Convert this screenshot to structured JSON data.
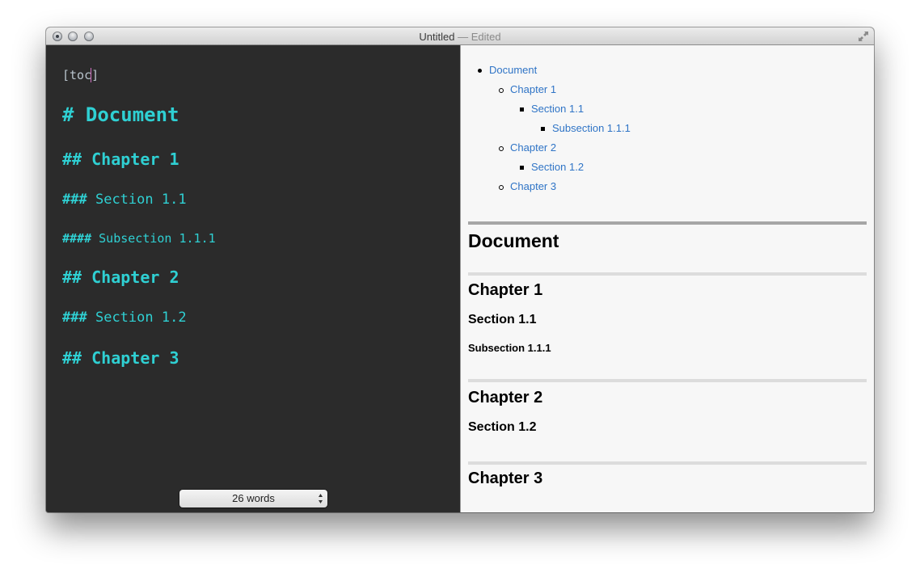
{
  "window": {
    "title": "Untitled",
    "separator": "—",
    "status": "Edited"
  },
  "editor": {
    "toc_tag_before_caret": "[toc",
    "toc_tag_after_caret": "]",
    "lines": [
      {
        "hash": "#",
        "text": "Document",
        "level": 1
      },
      {
        "hash": "##",
        "text": "Chapter 1",
        "level": 2
      },
      {
        "hash": "###",
        "text": "Section 1.1",
        "level": 3
      },
      {
        "hash": "####",
        "text": "Subsection 1.1.1",
        "level": 4
      },
      {
        "hash": "##",
        "text": "Chapter 2",
        "level": 2
      },
      {
        "hash": "###",
        "text": "Section 1.2",
        "level": 3
      },
      {
        "hash": "##",
        "text": "Chapter 3",
        "level": 2
      }
    ],
    "word_count": "26 words",
    "heading_color": "#2fd0d3",
    "background": "#2b2b2b"
  },
  "preview": {
    "toc": [
      {
        "label": "Document",
        "level": 1
      },
      {
        "label": "Chapter 1",
        "level": 2
      },
      {
        "label": "Section 1.1",
        "level": 3
      },
      {
        "label": "Subsection 1.1.1",
        "level": 4
      },
      {
        "label": "Chapter 2",
        "level": 2
      },
      {
        "label": "Section 1.2",
        "level": 3
      },
      {
        "label": "Chapter 3",
        "level": 2
      }
    ],
    "headings": [
      {
        "text": "Document",
        "level": 1
      },
      {
        "text": "Chapter 1",
        "level": 2
      },
      {
        "text": "Section 1.1",
        "level": 3
      },
      {
        "text": "Subsection 1.1.1",
        "level": 4
      },
      {
        "text": "Chapter 2",
        "level": 2
      },
      {
        "text": "Section 1.2",
        "level": 3
      },
      {
        "text": "Chapter 3",
        "level": 2
      }
    ],
    "link_color": "#2f74c6"
  }
}
